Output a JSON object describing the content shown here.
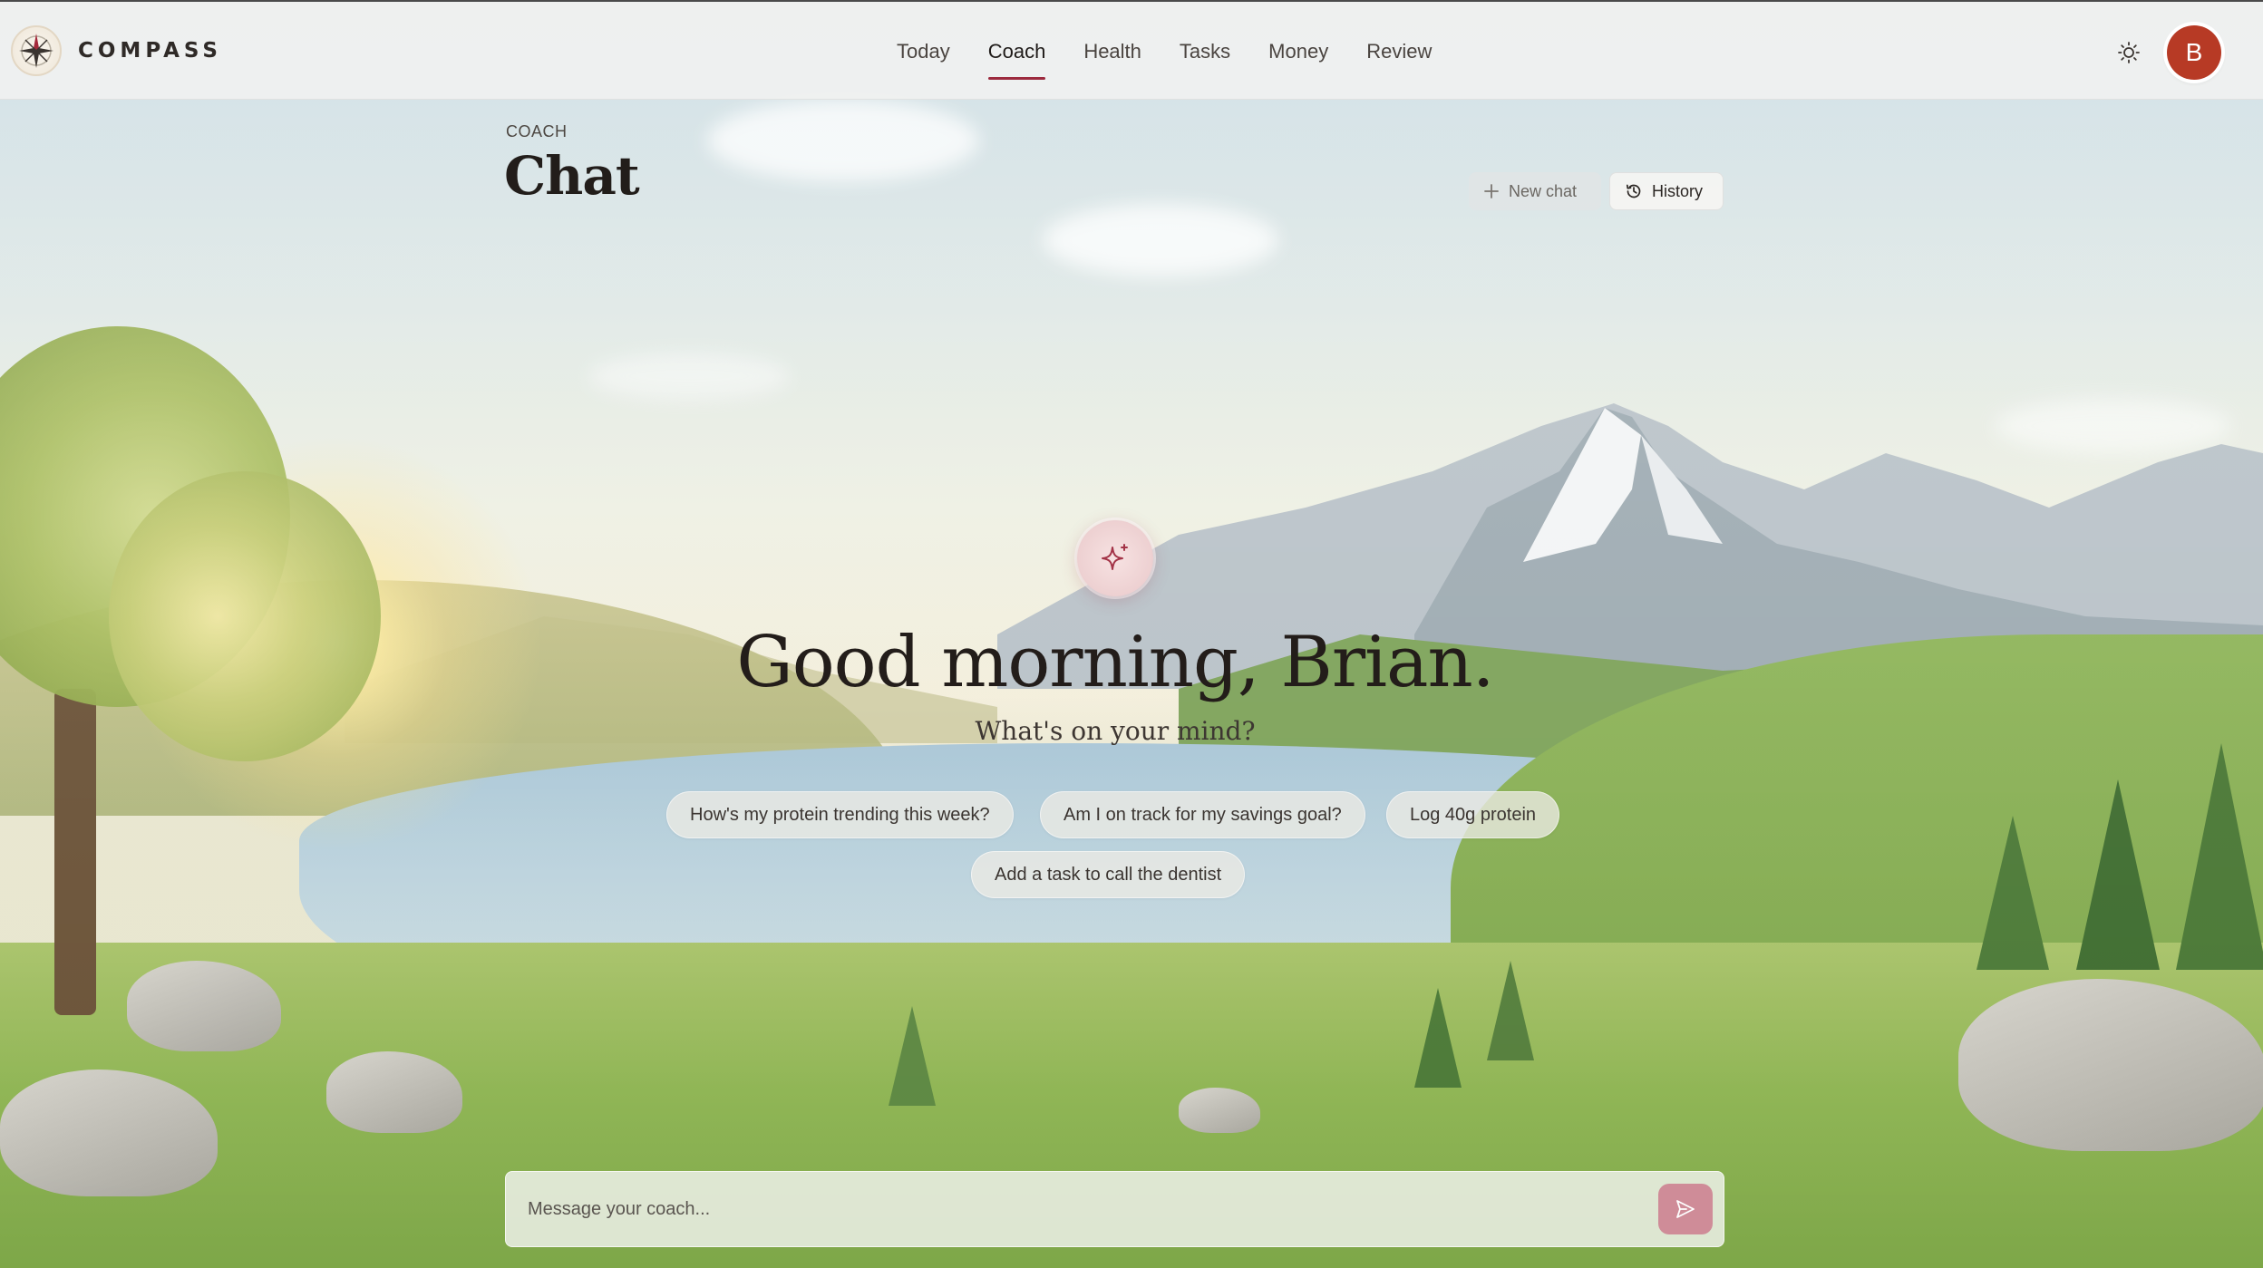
{
  "app": {
    "brand": "COMPASS",
    "user_initial": "B"
  },
  "nav": {
    "items": [
      {
        "label": "Today",
        "active": false
      },
      {
        "label": "Coach",
        "active": true
      },
      {
        "label": "Health",
        "active": false
      },
      {
        "label": "Tasks",
        "active": false
      },
      {
        "label": "Money",
        "active": false
      },
      {
        "label": "Review",
        "active": false
      }
    ]
  },
  "page": {
    "eyebrow": "COACH",
    "title": "Chat",
    "new_chat_label": "New chat",
    "history_label": "History"
  },
  "main": {
    "greeting": "Good morning, Brian.",
    "subgreeting": "What's on your mind?",
    "suggestions": [
      "How's my protein trending this week?",
      "Am I on track for my savings goal?",
      "Log 40g protein",
      "Add a task to call the dentist"
    ]
  },
  "composer": {
    "placeholder": "Message your coach..."
  },
  "colors": {
    "accent": "#9c2a3e",
    "avatar_bg": "#b73a25",
    "send_button": "#cf8c98"
  },
  "icons": {
    "logo": "compass-logo-icon",
    "theme": "sun-icon",
    "new_chat": "plus-icon",
    "history": "history-icon",
    "spark": "sparkle-icon",
    "send": "send-icon"
  }
}
